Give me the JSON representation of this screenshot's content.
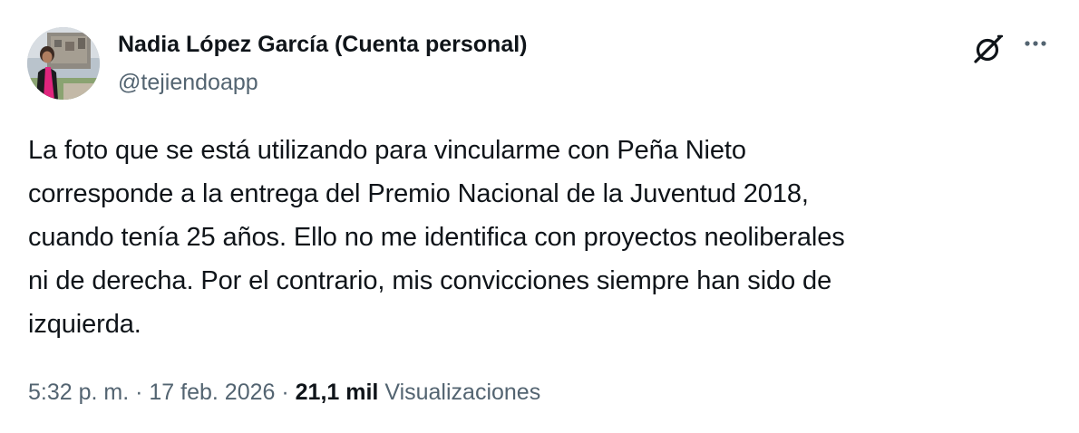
{
  "author": {
    "display_name": "Nadia López García (Cuenta personal)",
    "handle": "@tejiendoapp"
  },
  "icons": {
    "grok": "grok-icon",
    "more": "more-options-icon"
  },
  "tweet": {
    "lines": [
      "La foto que se está utilizando para vincularme con Peña Nieto",
      "corresponde a la entrega del Premio Nacional de la Juventud 2018,",
      "cuando tenía 25 años.  Ello no me identifica con proyectos neoliberales",
      "ni de derecha. Por el contrario, mis convicciones siempre han sido de",
      "izquierda."
    ]
  },
  "meta": {
    "time": "5:32 p. m.",
    "separator": "·",
    "date": "17 feb. 2026",
    "views_count": "21,1 mil",
    "views_label": "Visualizaciones"
  },
  "colors": {
    "text_primary": "#0f1419",
    "text_secondary": "#536471",
    "accent_pink": "#e0257d"
  }
}
